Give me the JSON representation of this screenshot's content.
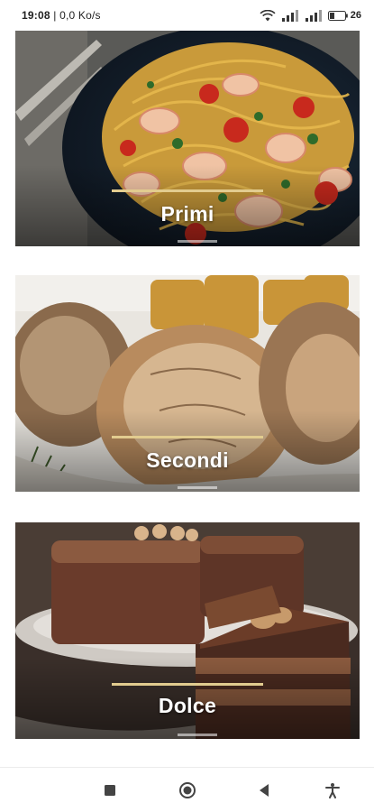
{
  "status_bar": {
    "time": "19:08",
    "network_speed": "0,0 Ko/s",
    "battery_level": "26"
  },
  "categories": [
    {
      "id": "primi",
      "title": "Primi"
    },
    {
      "id": "secondi",
      "title": "Secondi"
    },
    {
      "id": "dolce",
      "title": "Dolce"
    }
  ],
  "navigation": {
    "buttons": [
      "recent-apps",
      "home",
      "back",
      "accessibility"
    ]
  },
  "colors": {
    "accent_line": "#e2cc8f",
    "title_text": "#ffffff"
  }
}
